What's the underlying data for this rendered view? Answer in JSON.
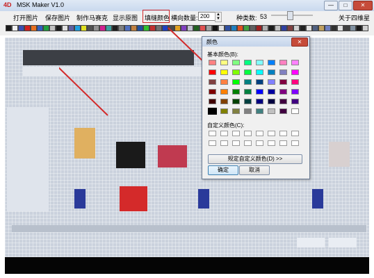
{
  "app": {
    "title": "MSK Maker V1.0",
    "logo": "4D",
    "min_glyph": "—",
    "max_glyph": "□",
    "close_glyph": "✕"
  },
  "menu": {
    "open_image": "打开图片",
    "save_image": "保存图片",
    "make_mosaic": "制作马赛克",
    "show_original": "显示原图",
    "fill_color": "填缝颜色",
    "horizontal_count_label": "横向数量:",
    "horizontal_count_value": "200",
    "kinds_label": "种类数:",
    "kinds_value": "53",
    "about": "关于四维星"
  },
  "palette_colors": [
    "#1a1a1a",
    "#f0f0f0",
    "#3a4fb0",
    "#d02020",
    "#e87020",
    "#3060c0",
    "#20a040",
    "#c0c0c0",
    "#1c1c1c",
    "#e0e0e0",
    "#6060a0",
    "#20a0e0",
    "#e0e020",
    "#505050",
    "#909090",
    "#d02090",
    "#3aa0a0",
    "#1e1e1e",
    "#808080",
    "#5070c0",
    "#c08040",
    "#2050a0",
    "#30c030",
    "#c03030",
    "#707070",
    "#2040c0",
    "#4a4a4a",
    "#e0a020",
    "#8040c0",
    "#c0c0d0",
    "#206020",
    "#e05050",
    "#a0a0a0",
    "#101010",
    "#e0e0e0",
    "#3050a0",
    "#2080c0",
    "#e05020",
    "#40a040",
    "#606060",
    "#a02020",
    "#b0b0b0",
    "#1a1a1a",
    "#c0c0c0",
    "#3040a0",
    "#804040",
    "#d0d0d0",
    "#202020",
    "#e0e0e0",
    "#506080",
    "#c0a060",
    "#7080c0",
    "#303030",
    "#e0e0e0",
    "#404040",
    "#8090a0",
    "#1a1a1a",
    "#d0d0d0"
  ],
  "color_dialog": {
    "title": "颜色",
    "close_glyph": "✕",
    "basic_colors_label": "基本颜色(B):",
    "basic_colors": [
      [
        "#ff8080",
        "#ffff80",
        "#80ff80",
        "#00ff80",
        "#80ffff",
        "#0080ff",
        "#ff80c0",
        "#ff80ff"
      ],
      [
        "#ff0000",
        "#ffff00",
        "#80ff00",
        "#00ff40",
        "#00ffff",
        "#0080c0",
        "#8080c0",
        "#ff00ff"
      ],
      [
        "#804040",
        "#ff8040",
        "#00ff00",
        "#008080",
        "#004080",
        "#8080ff",
        "#800040",
        "#ff0080"
      ],
      [
        "#800000",
        "#ff8000",
        "#008000",
        "#008040",
        "#0000ff",
        "#0000a0",
        "#800080",
        "#8000ff"
      ],
      [
        "#400000",
        "#804000",
        "#004000",
        "#004040",
        "#000080",
        "#000040",
        "#400040",
        "#400080"
      ],
      [
        "#000000",
        "#808000",
        "#808040",
        "#808080",
        "#408080",
        "#c0c0c0",
        "#400040",
        "#ffffff"
      ]
    ],
    "selected_basic_color": "#000000",
    "custom_colors_label": "自定义颜色(C):",
    "custom_colors": [
      "#ffffff",
      "#ffffff",
      "#ffffff",
      "#ffffff",
      "#ffffff",
      "#ffffff",
      "#ffffff",
      "#ffffff",
      "#ffffff",
      "#ffffff",
      "#ffffff",
      "#ffffff",
      "#ffffff",
      "#ffffff",
      "#ffffff",
      "#ffffff"
    ],
    "define_custom_label": "规定自定义颜色(D) >>",
    "ok_label": "确定",
    "cancel_label": "取消"
  },
  "accent_color": "#d32a2a"
}
